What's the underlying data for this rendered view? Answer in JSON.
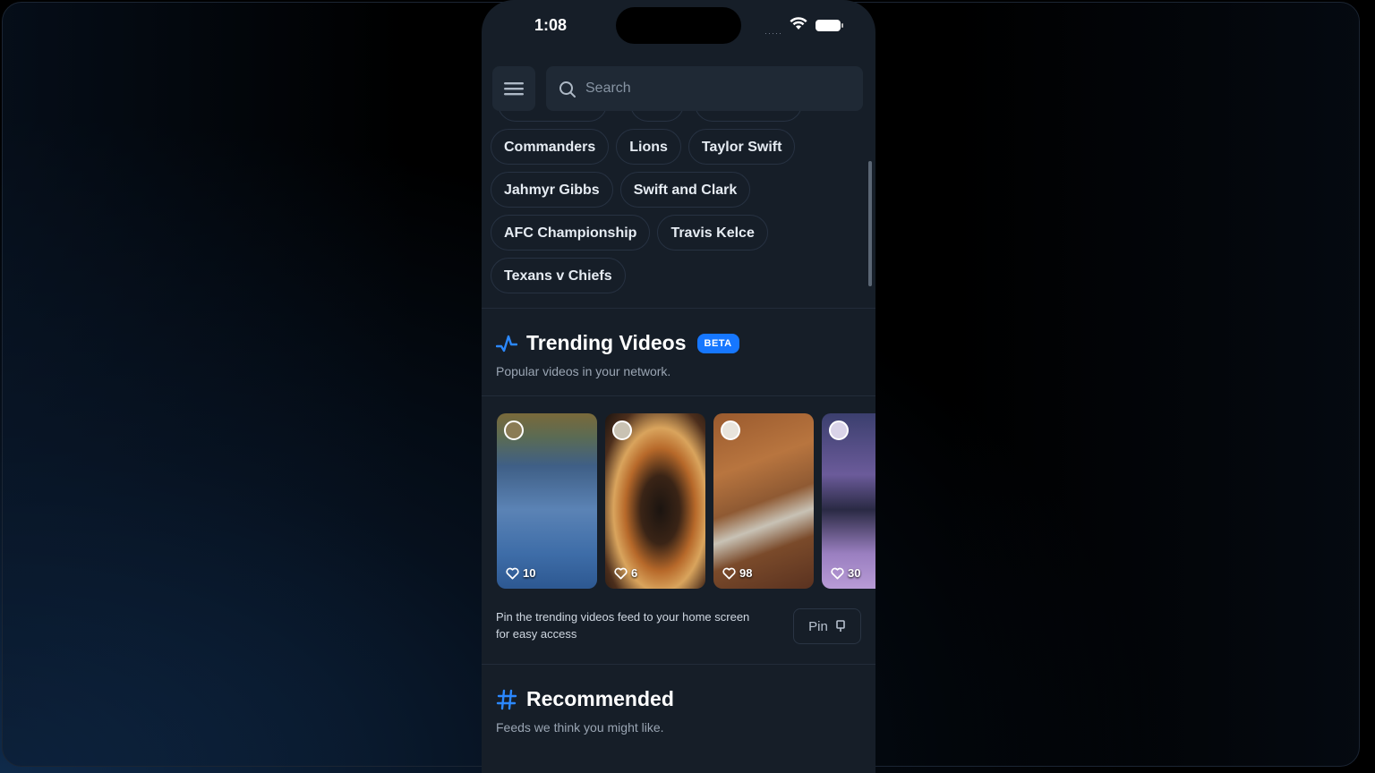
{
  "status": {
    "time": "1:08",
    "signal": "·····"
  },
  "search": {
    "placeholder": "Search"
  },
  "chips": [
    [
      "Commanders",
      "Lions",
      "Taylor Swift"
    ],
    [
      "Jahmyr Gibbs",
      "Swift and Clark"
    ],
    [
      "AFC Championship",
      "Travis Kelce"
    ],
    [
      "Texans v Chiefs"
    ]
  ],
  "trending": {
    "title": "Trending Videos",
    "badge": "BETA",
    "subtitle": "Popular videos in your network.",
    "videos": [
      {
        "likes": "10"
      },
      {
        "likes": "6"
      },
      {
        "likes": "98"
      },
      {
        "likes": "30"
      }
    ],
    "pin_text": "Pin the trending videos feed to your home screen for easy access",
    "pin_label": "Pin"
  },
  "recommended": {
    "title": "Recommended",
    "subtitle": "Feeds we think you might like."
  },
  "colors": {
    "accent": "#1677ff",
    "background": "#161e28",
    "surface": "#1f2935"
  }
}
